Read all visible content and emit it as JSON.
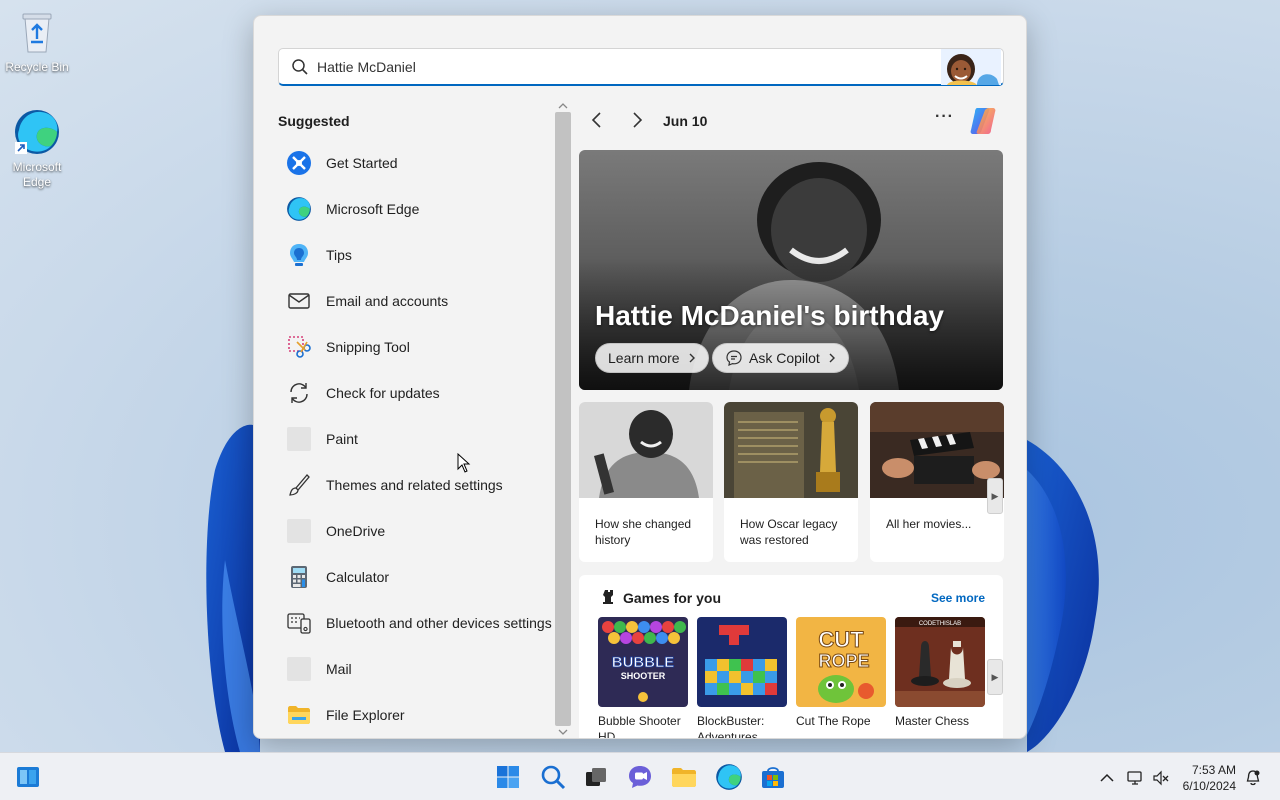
{
  "desktop": {
    "icons": [
      {
        "label": "Recycle Bin"
      },
      {
        "label": "Microsoft Edge"
      }
    ]
  },
  "search": {
    "value": "Hattie McDaniel",
    "placeholder": ""
  },
  "suggested": {
    "title": "Suggested",
    "items": [
      {
        "label": "Get Started",
        "icon": "get-started-icon"
      },
      {
        "label": "Microsoft Edge",
        "icon": "edge-icon"
      },
      {
        "label": "Tips",
        "icon": "tips-icon"
      },
      {
        "label": "Email and accounts",
        "icon": "mail-envelope-icon"
      },
      {
        "label": "Snipping Tool",
        "icon": "snipping-tool-icon"
      },
      {
        "label": "Check for updates",
        "icon": "refresh-icon"
      },
      {
        "label": "Paint",
        "icon": "paint-icon"
      },
      {
        "label": "Themes and related settings",
        "icon": "brush-icon"
      },
      {
        "label": "OneDrive",
        "icon": "onedrive-icon"
      },
      {
        "label": "Calculator",
        "icon": "calculator-icon"
      },
      {
        "label": "Bluetooth and other devices settings",
        "icon": "devices-icon"
      },
      {
        "label": "Mail",
        "icon": "mail-icon"
      },
      {
        "label": "File Explorer",
        "icon": "folder-icon"
      }
    ]
  },
  "highlights": {
    "date": "Jun 10",
    "more": "···",
    "hero": {
      "title": "Hattie McDaniel's birthday",
      "learn_more": "Learn more",
      "ask_copilot": "Ask Copilot"
    },
    "cards": [
      {
        "caption": "How she changed history"
      },
      {
        "caption": "How Oscar legacy was restored"
      },
      {
        "caption": "All her movies..."
      }
    ]
  },
  "games": {
    "title": "Games for you",
    "see_more": "See more",
    "items": [
      {
        "name": "Bubble Shooter HD"
      },
      {
        "name": "BlockBuster: Adventures ..."
      },
      {
        "name": "Cut The Rope"
      },
      {
        "name": "Master Chess"
      }
    ]
  },
  "clock": {
    "time": "7:53 AM",
    "date": "6/10/2024"
  }
}
